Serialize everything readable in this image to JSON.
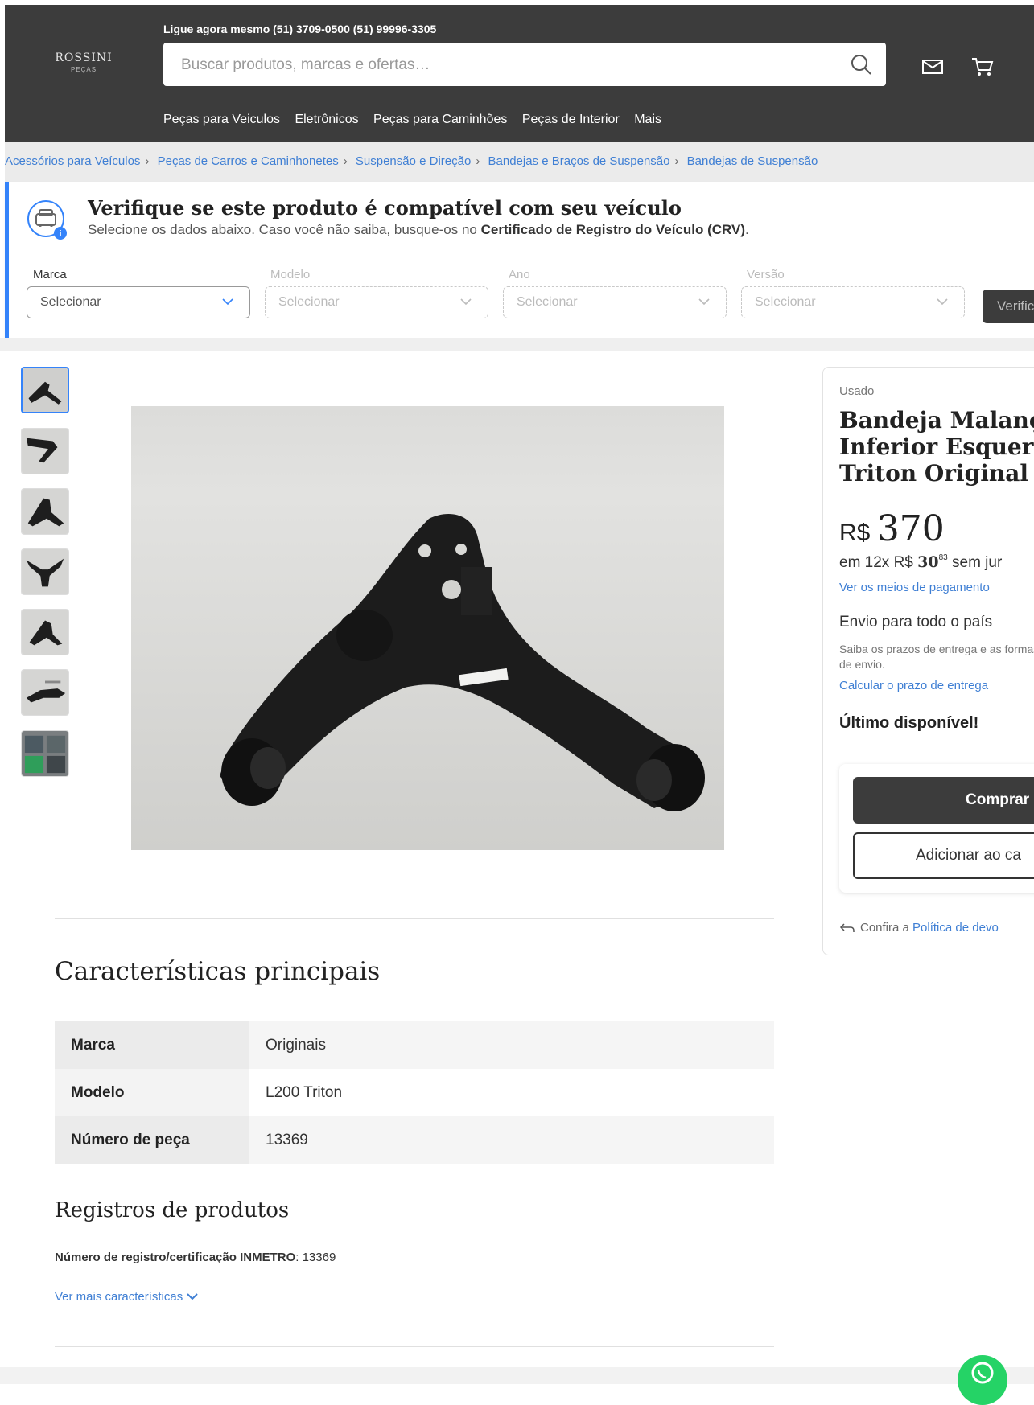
{
  "header": {
    "logo_line1": "ROSSINI",
    "logo_line2": "PEÇAS",
    "phone": "Ligue agora mesmo (51) 3709-0500  (51) 99996-3305",
    "search_placeholder": "Buscar produtos, marcas e ofertas…",
    "nav": [
      "Peças para Veiculos",
      "Eletrônicos",
      "Peças para Caminhões",
      "Peças de Interior",
      "Mais"
    ]
  },
  "breadcrumb": [
    "Acessórios para Veículos",
    "Peças de Carros e Caminhonetes",
    "Suspensão e Direção",
    "Bandejas e Braços de Suspensão",
    "Bandejas de Suspensão"
  ],
  "compat": {
    "title": "Verifique se este produto é compatível com seu veículo",
    "sub_prefix": "Selecione os dados abaixo. Caso você não saiba, busque-os no ",
    "sub_bold": "Certificado de Registro do Veículo (CRV)",
    "sub_suffix": ".",
    "fields": [
      {
        "label": "Marca",
        "value": "Selecionar"
      },
      {
        "label": "Modelo",
        "value": "Selecionar"
      },
      {
        "label": "Ano",
        "value": "Selecionar"
      },
      {
        "label": "Versão",
        "value": "Selecionar"
      }
    ],
    "verify_label": "Verific"
  },
  "product": {
    "condition": "Usado",
    "title_lines": [
      "Bandeja Malança",
      "Inferior Esquerd",
      "Triton Original ("
    ],
    "price_currency": "R$",
    "price_value": "370",
    "installments_prefix": "em 12x R$ ",
    "installments_amount": "30",
    "installments_cents": "83",
    "installments_suffix": " sem jur",
    "payment_link": "Ver os meios de pagamento",
    "shipping": "Envio para todo o país",
    "shipping_sub": "Saiba os prazos de entrega e as formas de envio.",
    "shipping_link": "Calcular o prazo de entrega",
    "stock": "Último disponível!",
    "buy_label": "Comprar",
    "cart_label": "Adicionar ao ca",
    "returns_prefix": "Confira a ",
    "returns_link": "Política de devo"
  },
  "specs": {
    "title": "Características principais",
    "rows": [
      {
        "k": "Marca",
        "v": "Originais"
      },
      {
        "k": "Modelo",
        "v": "L200 Triton"
      },
      {
        "k": "Número de peça",
        "v": "13369"
      }
    ]
  },
  "registry": {
    "title": "Registros de produtos",
    "label": "Número de registro/certificação INMETRO",
    "value": ": 13369",
    "more_link": "Ver mais características"
  },
  "colors": {
    "header_bg": "#3c3c3c",
    "accent_blue": "#3483fa",
    "link_blue": "#3f7fd4",
    "whatsapp": "#25d366"
  },
  "icons": [
    "search-icon",
    "mail-icon",
    "cart-icon",
    "car-info-icon",
    "chevron-down-icon",
    "return-arrow-icon",
    "whatsapp-icon"
  ]
}
